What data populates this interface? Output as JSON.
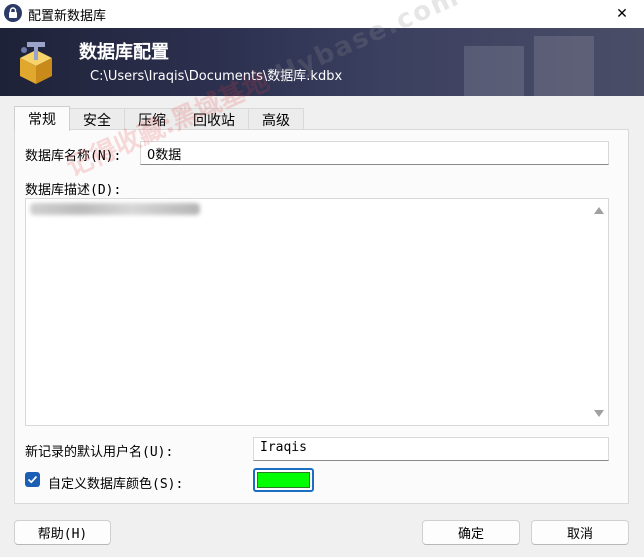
{
  "window": {
    "title": "配置新数据库",
    "close_glyph": "✕"
  },
  "banner": {
    "title": "数据库配置",
    "path": "C:\\Users\\Iraqis\\Documents\\数据库.kdbx"
  },
  "tabs": [
    {
      "label": "常规",
      "active": true
    },
    {
      "label": "安全",
      "active": false
    },
    {
      "label": "压缩",
      "active": false
    },
    {
      "label": "回收站",
      "active": false
    },
    {
      "label": "高级",
      "active": false
    }
  ],
  "general": {
    "name_label": "数据库名称(N):",
    "name_value": "0数据",
    "desc_label": "数据库描述(D):",
    "default_user_label": "新记录的默认用户名(U):",
    "default_user_value": "Iraqis",
    "custom_color_label": "自定义数据库颜色(S):",
    "custom_color_checked": true,
    "custom_color": "#00ff00"
  },
  "buttons": {
    "help": "帮助(H)",
    "ok": "确定",
    "cancel": "取消"
  },
  "watermark": {
    "cn": "记得收藏:黑域基地",
    "en": "Hybase.com"
  },
  "colors": {
    "accent": "#1a5fb4",
    "banner_dark": "#1e2238"
  },
  "icons": {
    "app": "lock-icon",
    "banner": "database-config-icon",
    "close": "close-icon",
    "check": "checkmark-icon"
  }
}
